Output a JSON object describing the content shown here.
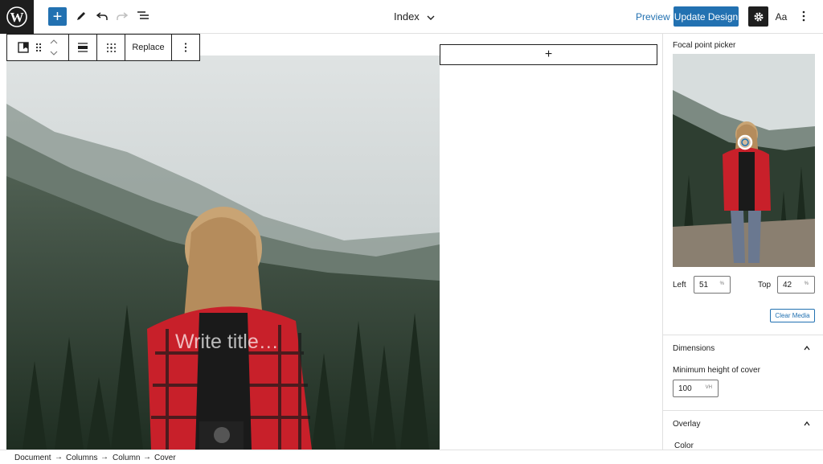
{
  "header": {
    "doc_title": "Index",
    "preview_label": "Preview",
    "update_label": "Update Design",
    "styles_label": "Aa"
  },
  "block_toolbar": {
    "replace_label": "Replace"
  },
  "cover": {
    "placeholder": "Write title…"
  },
  "sidebar": {
    "focal_label": "Focal point picker",
    "left_label": "Left",
    "left_value": "51",
    "left_unit": "%",
    "top_label": "Top",
    "top_value": "42",
    "top_unit": "%",
    "clear_label": "Clear Media",
    "dimensions_title": "Dimensions",
    "min_height_label": "Minimum height of cover",
    "min_height_value": "100",
    "min_height_unit": "VH",
    "overlay_title": "Overlay",
    "color_label": "Color"
  },
  "breadcrumb": [
    "Document",
    "Columns",
    "Column",
    "Cover"
  ],
  "colors": {
    "accent": "#2271b1",
    "dark": "#1e1e1e",
    "jacket_red": "#c8202a"
  }
}
